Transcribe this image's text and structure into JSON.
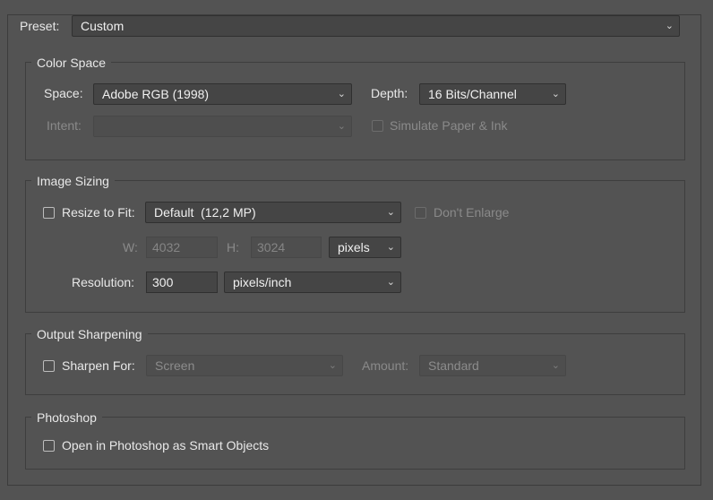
{
  "preset": {
    "label": "Preset:",
    "value": "Custom"
  },
  "color_space": {
    "title": "Color Space",
    "space_label": "Space:",
    "space_value": "Adobe RGB (1998)",
    "depth_label": "Depth:",
    "depth_value": "16 Bits/Channel",
    "intent_label": "Intent:",
    "intent_value": "",
    "simulate_label": "Simulate Paper & Ink"
  },
  "image_sizing": {
    "title": "Image Sizing",
    "resize_label": "Resize to Fit:",
    "resize_value": "Default  (12,2 MP)",
    "dont_enlarge_label": "Don't Enlarge",
    "w_label": "W:",
    "w_value": "4032",
    "h_label": "H:",
    "h_value": "3024",
    "unit_value": "pixels",
    "resolution_label": "Resolution:",
    "resolution_value": "300",
    "resolution_unit": "pixels/inch"
  },
  "output_sharpening": {
    "title": "Output Sharpening",
    "sharpen_label": "Sharpen For:",
    "sharpen_value": "Screen",
    "amount_label": "Amount:",
    "amount_value": "Standard"
  },
  "photoshop": {
    "title": "Photoshop",
    "smart_objects_label": "Open in Photoshop as Smart Objects"
  }
}
